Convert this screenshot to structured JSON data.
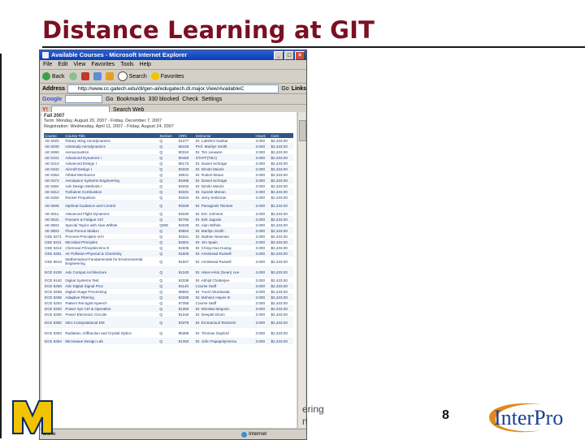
{
  "slide": {
    "title": "Distance Learning at GIT",
    "footer_line1": "ering",
    "footer_line2": "n",
    "page_number": "8",
    "logo_text": "InterPro",
    "logo_letter": "M"
  },
  "browser": {
    "window_title": "Available Courses - Microsoft Internet Explorer",
    "menu": [
      "File",
      "Edit",
      "View",
      "Favorites",
      "Tools",
      "Help"
    ],
    "toolbar": {
      "back": "Back",
      "search": "Search",
      "favorites": "Favorites"
    },
    "address_label": "Address",
    "address_value": "http://www.cc.gatech.edu/dl/gen-al/edugatech.dl.major.View/AvailableC",
    "go_label": "Go",
    "links_label": "Links",
    "google_label": "Google",
    "gbar": {
      "go": "Go",
      "bookmarks": "Bookmarks",
      "blocked": "330 blocked",
      "check": "Check",
      "settings": "Settings"
    },
    "yahoo_label": "Y!",
    "search_web_label": "Search Web",
    "status": "Done",
    "zone": "Internet"
  },
  "page": {
    "term_title": "Fall 2007",
    "term_dates": "Term: Monday, August 20, 2007 - Friday, December 7, 2007",
    "registration": "Registration: Wednesday, April 11, 2007 - Friday, August 24, 2007",
    "columns": [
      "Course",
      "Course Title",
      "Section",
      "CRN",
      "Instructor",
      "Hours",
      "Cost"
    ],
    "rows": [
      [
        "AE 6020",
        "Rotary Wing Aerodynamics",
        "Q",
        "81377",
        "Dr. Lakshmi Sankar",
        "3.000",
        "$2,433.00"
      ],
      [
        "AE 6030",
        "Unsteady Aerodynamics",
        "Q",
        "86440",
        "Prof. Marilyn Smith",
        "3.000",
        "$2,433.00"
      ],
      [
        "AE 6060",
        "Aeroacoustics",
        "Q",
        "90310",
        "Dr. Tim Lieuwen",
        "3.000",
        "$2,433.00"
      ],
      [
        "AE 6101",
        "Advanced Dynamics I",
        "Q",
        "80483",
        "STAFF(TBA)",
        "3.000",
        "$2,433.00"
      ],
      [
        "AE 6210",
        "Advanced Design I",
        "Q",
        "85173",
        "Dr. Daniel Schrage",
        "3.000",
        "$2,433.00"
      ],
      [
        "AE 6342",
        "Aircraft Design I",
        "Q",
        "93333",
        "Dr. Dimitri Mavris",
        "3.000",
        "$2,433.00"
      ],
      [
        "AE 6353",
        "Orbital Mechanics",
        "Q",
        "28631",
        "Dr. Robert Braun",
        "3.000",
        "$2,433.00"
      ],
      [
        "AE 6372",
        "Aerospace Systems Engineering",
        "Q",
        "83485",
        "Dr. Daniel Schrage",
        "3.000",
        "$2,433.00"
      ],
      [
        "AE 6382",
        "Adv Design Methods I",
        "Q",
        "93332",
        "Dr. Dimitri Mavris",
        "3.000",
        "$2,433.00"
      ],
      [
        "AE 6412",
        "Turbulent Combustion",
        "Q",
        "93331",
        "Dr. Suresh Menon",
        "3.000",
        "$2,433.00"
      ],
      [
        "AE 6450",
        "Rocket Propulsion",
        "Q",
        "93334",
        "Dr. Jerry Seitzman",
        "3.000",
        "$2,433.00"
      ],
      [
        "AE 6505",
        "Optimal Guidance and Control",
        "Q",
        "93329",
        "Dr. Panagiotis Tsiotras",
        "3.000",
        "$2,433.00"
      ],
      [
        "AE 6511",
        "Advanced Flight Dynamics",
        "Q",
        "93330",
        "Dr. Eric Johnson",
        "3.000",
        "$2,433.00"
      ],
      [
        "AE 6531",
        "Fracture & Fatigue Ctrl",
        "Q",
        "92760",
        "Dr. Erik Jagoda",
        "3.000",
        "$2,433.00"
      ],
      [
        "AE 8803",
        "Special Topics with Alan Wilhite",
        "QWE",
        "93336",
        "Dr. Alan Wilhite",
        "3.000",
        "$2,433.00"
      ],
      [
        "AE 8803",
        "Flow-Porous Media I",
        "Q",
        "93553",
        "Dr. Marilyn Smith",
        "3.000",
        "$2,433.00"
      ],
      [
        "CEE 6271",
        "Process Principles Vol I",
        "Q",
        "93341",
        "Dr. Nathan Newman",
        "3.000",
        "$2,433.00"
      ],
      [
        "CEE 6311",
        "Microbial Principles",
        "Q",
        "83301",
        "Dr. Jim Spain",
        "3.000",
        "$2,433.00"
      ],
      [
        "CEE 6312",
        "Chemical Principles-Env E",
        "Q",
        "91505",
        "Dr. Ching-Hua Huang",
        "3.000",
        "$2,433.00"
      ],
      [
        "CEE 6351",
        "Air Pollution-Physical & Chemistry",
        "Q",
        "91505",
        "Dr. Armistead Russell",
        "3.000",
        "$2,433.00"
      ],
      [
        "CEE 8813",
        "Mathematical Fundamentals for Environmental Engineering",
        "Q",
        "91507",
        "Dr. Armistead Russell",
        "3.000",
        "$2,433.00"
      ],
      [
        "ECE 6100",
        "Adv Comput Architecture",
        "Q",
        "91340",
        "Dr. Hsien-Hsin (Sean) Lee",
        "3.000",
        "$2,433.00"
      ],
      [
        "ECE 6140",
        "Digital Systems Test",
        "Q",
        "93339",
        "Dr. Abhijit Chatterjee",
        "3.000",
        "$2,433.00"
      ],
      [
        "ECE 6250",
        "Adv Digital Signal Proc",
        "Q",
        "81140",
        "Course Staff",
        "3.000",
        "$2,433.00"
      ],
      [
        "ECE 6258",
        "Digital Image Processing",
        "Q",
        "86562",
        "Dr. Yucel Altunbasak",
        "3.000",
        "$2,433.00"
      ],
      [
        "ECE 6255",
        "Adaptive Filtering",
        "Q",
        "93338",
        "Dr. Mohsen Hayes III",
        "3.000",
        "$2,433.00"
      ],
      [
        "ECE 6254",
        "Pattern Recognit-Speech",
        "Q",
        "87358",
        "Course Staff",
        "3.000",
        "$2,433.00"
      ],
      [
        "ECE 6320",
        "Power Sys Ctrl & Operation",
        "Q",
        "81350",
        "Dr. Miroslav Begovic",
        "3.000",
        "$2,433.00"
      ],
      [
        "ECE 6330",
        "Power Electronic Circuits",
        "Q",
        "81340",
        "Dr. Deepak Divan",
        "3.000",
        "$2,433.00"
      ],
      [
        "ECE 6350",
        "Intro Computational EM",
        "Q",
        "93378",
        "Dr. Emmanouil Tentzeris",
        "3.000",
        "$2,433.00"
      ],
      [
        "ECE 6353",
        "Radiation, Diffraction and Crystal Optics",
        "Q",
        "85368",
        "Dr. Thomas Gaylord",
        "3.000",
        "$2,433.00"
      ],
      [
        "ECE 6364",
        "Microwave Design Lab",
        "Q",
        "91350",
        "Dr. John Papapolymerou",
        "3.000",
        "$2,433.00"
      ]
    ]
  },
  "colors": {
    "title": "#7a1022",
    "table_header": "#2f5588",
    "link": "#1a3a7a",
    "umich_maize": "#f2c300",
    "interpro_blue": "#1d3f8f"
  },
  "icons": [
    "back-arrow-icon",
    "search-icon",
    "favorites-star-icon",
    "ie-page-icon",
    "internet-zone-icon"
  ]
}
